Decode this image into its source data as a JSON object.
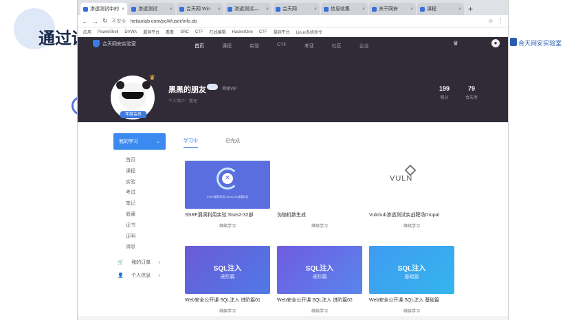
{
  "slide": {
    "title": "通过训",
    "side_logo": "合天网安实验室"
  },
  "browser": {
    "tabs": [
      {
        "label": "渗透测试中的"
      },
      {
        "label": "渗透测试"
      },
      {
        "label": "合天网 Win"
      },
      {
        "label": "渗透测试—"
      },
      {
        "label": "合天网"
      },
      {
        "label": "信息收集"
      },
      {
        "label": "关于网安"
      },
      {
        "label": "课程"
      }
    ],
    "new_tab": "+",
    "url_security": "不安全",
    "url": "hetianlab.com/pc/#/user/info.do",
    "bookmarks": [
      "应用",
      "PowerShell",
      "DVWA",
      "漏洞平台",
      "看看",
      "SRC",
      "CTF",
      "在线编辑",
      "HackerOne",
      "CTF",
      "漏洞平台",
      "Linux系统命令"
    ]
  },
  "site": {
    "brand": "合天网安实验室",
    "nav": [
      "首页",
      "课程",
      "实验",
      "CTF",
      "考证",
      "社区",
      "企业"
    ],
    "username": "黑黑的朋友",
    "level": "等级VIP",
    "sub": "个人简介：暂无",
    "vip_tag": "年度会员",
    "stats": [
      {
        "num": "199",
        "label": "积分"
      },
      {
        "num": "79",
        "label": "合天币"
      }
    ]
  },
  "sidebar": {
    "active": "我的学习",
    "items": [
      "首页",
      "课程",
      "实验",
      "考试",
      "笔记",
      "收藏",
      "证书",
      "证明",
      "消息"
    ],
    "groups": [
      {
        "icon": "cart-icon",
        "label": "我的订单"
      },
      {
        "icon": "user-icon",
        "label": "个人信息"
      }
    ]
  },
  "content": {
    "tabs": [
      "学习中",
      "已完成"
    ],
    "cards": [
      {
        "title": "SSRF漏洞利用实验 Stuts2-32部",
        "btn": "继续学习",
        "thumb": "ssrf"
      },
      {
        "title": "伪随机数生成",
        "btn": "继续学习",
        "thumb": "blank"
      },
      {
        "title": "Vulnhub渗透测试实战靶场Drupal",
        "btn": "继续学习",
        "thumb": "vuln"
      },
      {
        "title": "Web安全公开课 SQL注入 进阶篇01",
        "btn": "继续学习",
        "thumb_big": "SQL注入",
        "thumb_small": "进阶篇"
      },
      {
        "title": "Web安全公开课 SQL注入 进阶篇02",
        "btn": "继续学习",
        "thumb_big": "SQL注入",
        "thumb_small": "进阶篇"
      },
      {
        "title": "Web安全公开课 SQL注入 基础篇",
        "btn": "继续学习",
        "thumb_big": "SQL注入",
        "thumb_small": "基础篇"
      }
    ],
    "ssrf_caption": "SSRF漏洞利用 Stuts2-32部署实验"
  },
  "colors": {
    "header": "#302b36",
    "accent": "#3b8af0"
  }
}
